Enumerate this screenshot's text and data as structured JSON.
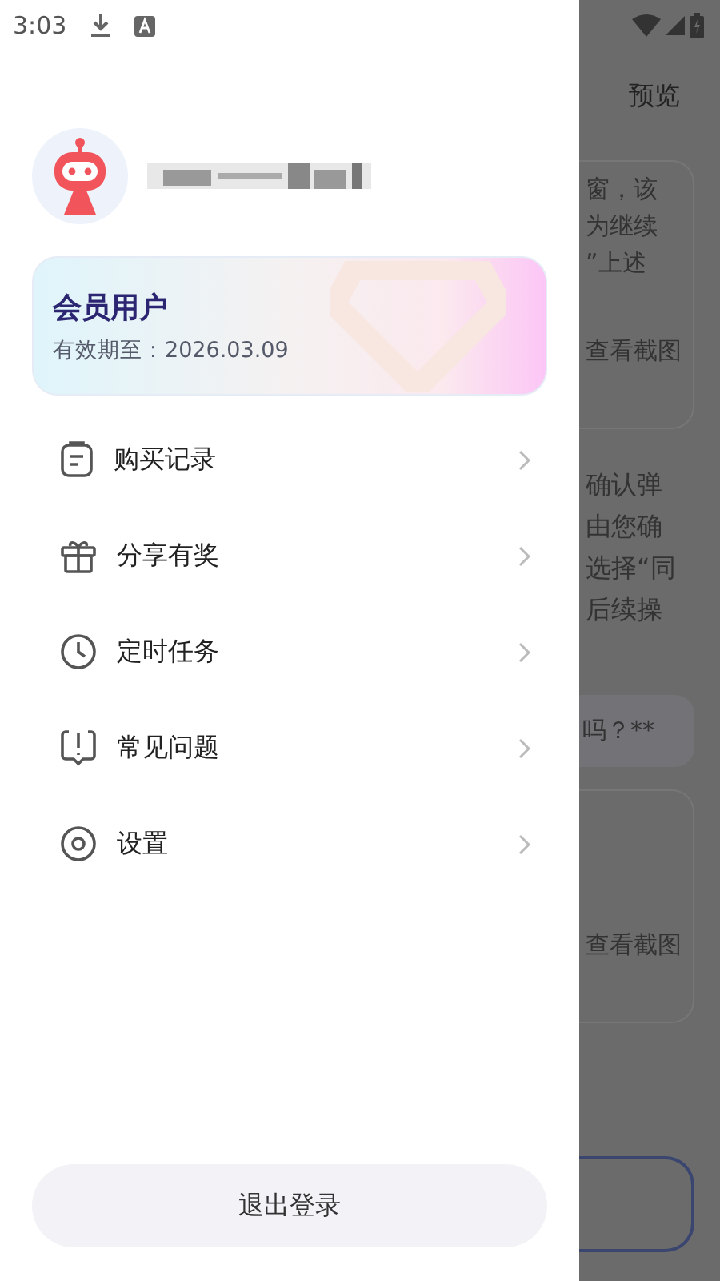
{
  "status_bar": {
    "time": "3:03"
  },
  "drawer": {
    "member_card": {
      "title": "会员用户",
      "expiry": "有效期至：2026.03.09"
    },
    "menu": [
      {
        "label": "购买记录",
        "kind": "clipboard"
      },
      {
        "label": "分享有奖",
        "kind": "gift"
      },
      {
        "label": "定时任务",
        "kind": "clock"
      },
      {
        "label": "常见问题",
        "kind": "faq"
      },
      {
        "label": "设置",
        "kind": "settings"
      }
    ],
    "logout_button": "退出登录"
  },
  "background_page": {
    "header_action": "预览",
    "blocks": [
      {
        "kind": "card",
        "lines": [
          "窗，该",
          "为继续",
          "”上述"
        ],
        "link": "查看截图"
      },
      {
        "kind": "text",
        "lines": [
          "确认弹",
          "由您确",
          "选择“同",
          "后续操"
        ]
      },
      {
        "kind": "pill",
        "lines": [
          "吗？**"
        ]
      },
      {
        "kind": "card",
        "link": "查看截图"
      }
    ]
  }
}
